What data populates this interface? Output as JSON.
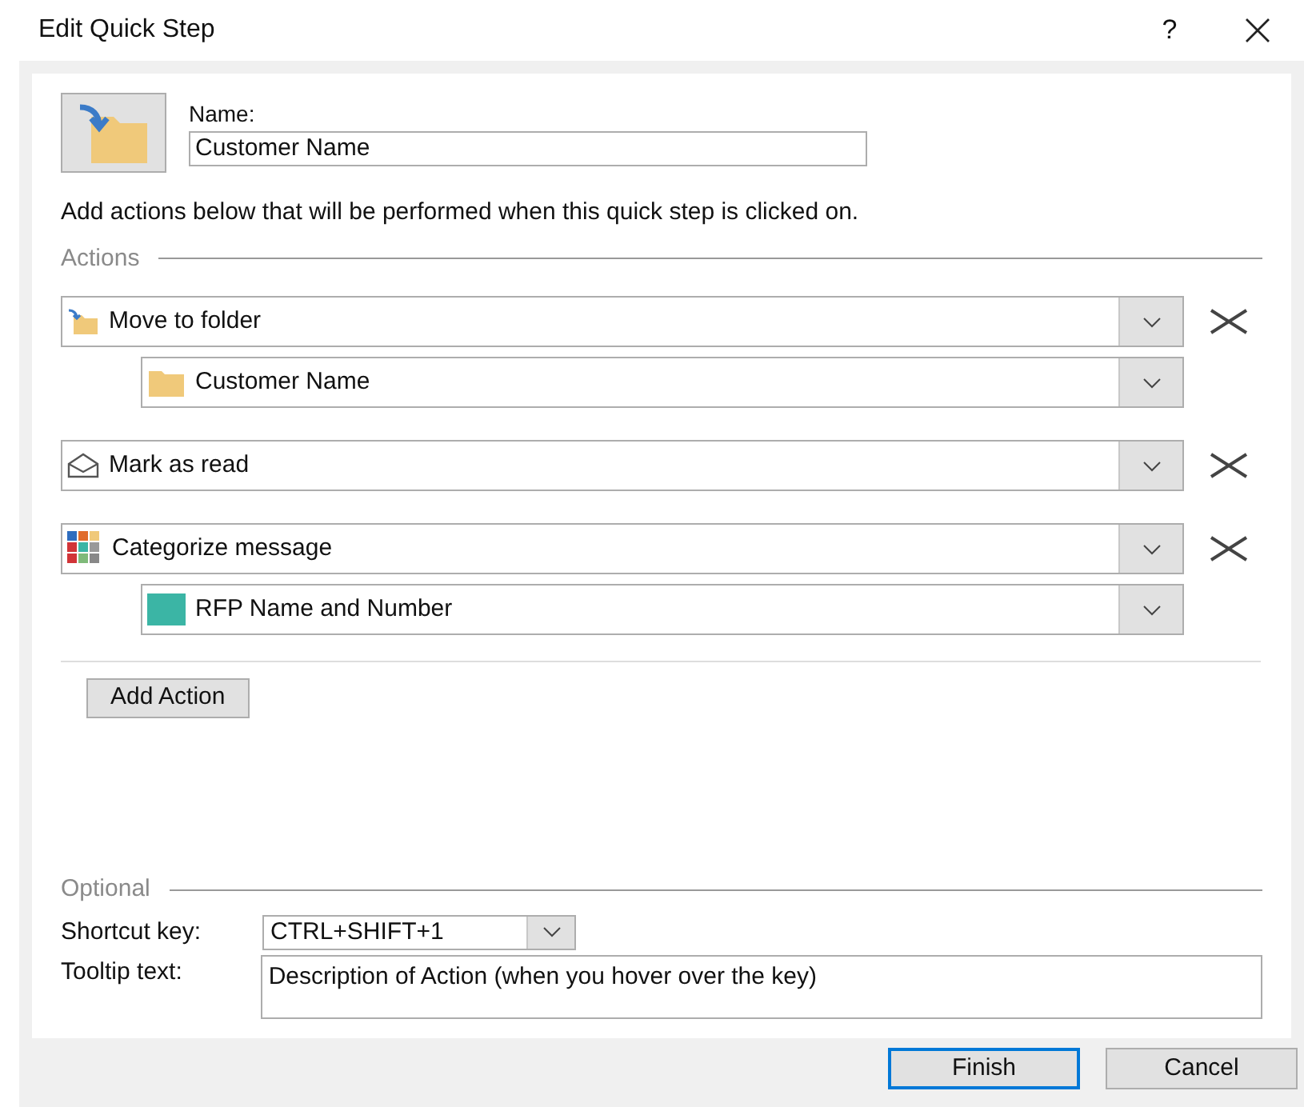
{
  "window": {
    "title": "Edit Quick Step",
    "help": "?"
  },
  "name_field": {
    "label": "Name:",
    "value": "Customer Name"
  },
  "instructions": "Add actions below that will be performed when this quick step is clicked on.",
  "actions_heading": "Actions",
  "actions": [
    {
      "label": "Move to folder",
      "kind": "move",
      "sub": {
        "label": "Customer Name",
        "kind": "folder"
      }
    },
    {
      "label": "Mark as read",
      "kind": "read"
    },
    {
      "label": "Categorize message",
      "kind": "categorize",
      "sub": {
        "label": "RFP Name and Number",
        "kind": "category",
        "color": "#3bb5a5"
      }
    }
  ],
  "add_action": "Add Action",
  "optional_heading": "Optional",
  "shortcut": {
    "label": "Shortcut key:",
    "value": "CTRL+SHIFT+1"
  },
  "tooltip": {
    "label": "Tooltip text:",
    "value": "Description of Action (when you hover over the key)"
  },
  "buttons": [
    {
      "label": "Finish",
      "default": true
    },
    {
      "label": "Cancel",
      "default": false
    }
  ]
}
